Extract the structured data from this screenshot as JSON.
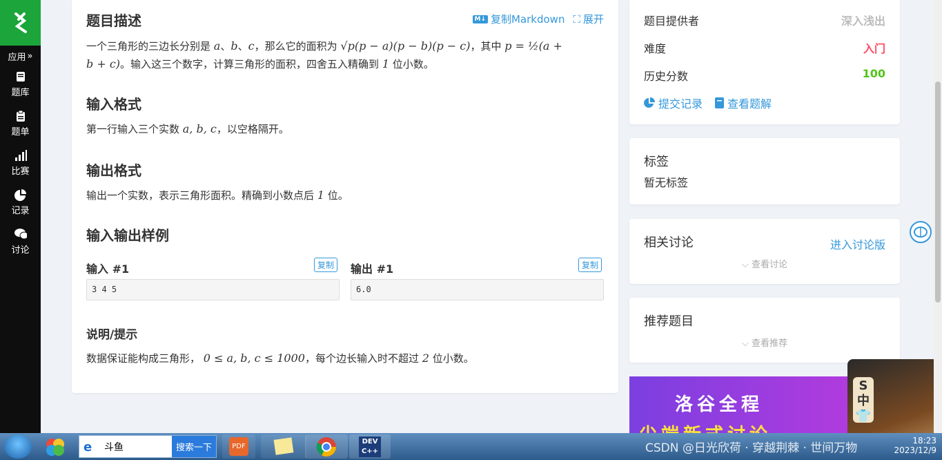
{
  "sidebar": {
    "app_label": "应用",
    "items": [
      {
        "label": "题库",
        "icon": "book-icon"
      },
      {
        "label": "题单",
        "icon": "clipboard-icon"
      },
      {
        "label": "比赛",
        "icon": "signal-bars-icon"
      },
      {
        "label": "记录",
        "icon": "pie-chart-icon"
      },
      {
        "label": "讨论",
        "icon": "chat-icon"
      }
    ]
  },
  "problem": {
    "desc_title": "题目描述",
    "copy_markdown": "复制Markdown",
    "expand": "展开",
    "desc_text_1": "一个三角形的三边长分别是",
    "desc_a": "a",
    "desc_sep1": "、",
    "desc_b": "b",
    "desc_sep2": "、",
    "desc_c": "c",
    "desc_text_2": "，那么它的面积为",
    "area_formula": "√p(p − a)(p − b)(p − c)",
    "desc_text_3": "，其中",
    "p_formula": "p = ½(a +",
    "p_formula_cont": "b + c)",
    "desc_text_4": "。输入这三个数字，计算三角形的面积，四舍五入精确到",
    "desc_one": "1",
    "desc_text_5": "位小数。",
    "input_title": "输入格式",
    "input_text_1": "第一行输入三个实数",
    "input_vars": "a, b, c",
    "input_text_2": "，以空格隔开。",
    "output_title": "输出格式",
    "output_text_1": "输出一个实数，表示三角形面积。精确到小数点后",
    "output_one": "1",
    "output_text_2": "位。",
    "samples_title": "输入输出样例",
    "input_sample_label": "输入 #1",
    "output_sample_label": "输出 #1",
    "copy_label": "复制",
    "input_sample": "3 4 5",
    "output_sample": "6.0",
    "hint_title": "说明/提示",
    "hint_text_1": "数据保证能构成三角形，",
    "hint_range": "0 ≤ a, b, c ≤ 1000",
    "hint_text_2": "，每个边长输入时不超过",
    "hint_two": "2",
    "hint_text_3": "位小数。"
  },
  "info": {
    "provider_label": "题目提供者",
    "provider_value": "深入浅出",
    "difficulty_label": "难度",
    "difficulty_value": "入门",
    "score_label": "历史分数",
    "score_value": "100",
    "submissions_link": "提交记录",
    "solutions_link": "查看题解"
  },
  "tags": {
    "title": "标签",
    "empty": "暂无标签"
  },
  "discussion": {
    "title": "相关讨论",
    "enter": "进入讨论版",
    "view": "查看讨论"
  },
  "recommend": {
    "title": "推荐题目",
    "view": "查看推荐"
  },
  "banner": {
    "line1": "洛谷全程",
    "line2": "尖端新式讨论"
  },
  "taskbar": {
    "search_query": "斗鱼",
    "search_button": "搜索一下",
    "time": "18:23",
    "date": "2023/12/9",
    "watermark": "CSDN @日光欣荷 · 穿越荆棘 · 世间万物"
  },
  "colors": {
    "green": "#1ba53a",
    "link": "#3498db",
    "difficulty": "#fe4c61",
    "score": "#52c41a"
  }
}
